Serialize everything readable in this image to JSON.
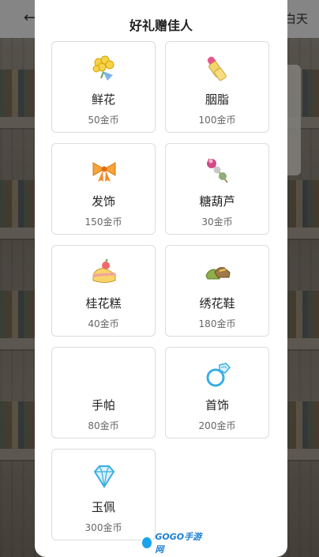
{
  "background": {
    "right_text": "白天",
    "back_icon": "arrow-left-icon"
  },
  "modal": {
    "title": "好礼赠佳人",
    "gifts": [
      {
        "name": "鲜花",
        "price": "50金币",
        "icon": "bouquet-icon"
      },
      {
        "name": "胭脂",
        "price": "100金币",
        "icon": "lipstick-icon"
      },
      {
        "name": "发饰",
        "price": "150金币",
        "icon": "bow-icon"
      },
      {
        "name": "糖葫芦",
        "price": "30金币",
        "icon": "candied-haws-icon"
      },
      {
        "name": "桂花糕",
        "price": "40金币",
        "icon": "cake-icon"
      },
      {
        "name": "绣花鞋",
        "price": "180金币",
        "icon": "shoes-icon"
      },
      {
        "name": "手帕",
        "price": "80金币",
        "icon": "handkerchief-icon"
      },
      {
        "name": "首饰",
        "price": "200金币",
        "icon": "ring-icon"
      },
      {
        "name": "玉佩",
        "price": "300金币",
        "icon": "diamond-icon"
      }
    ]
  },
  "watermark": {
    "text": "GOGO手游网"
  }
}
